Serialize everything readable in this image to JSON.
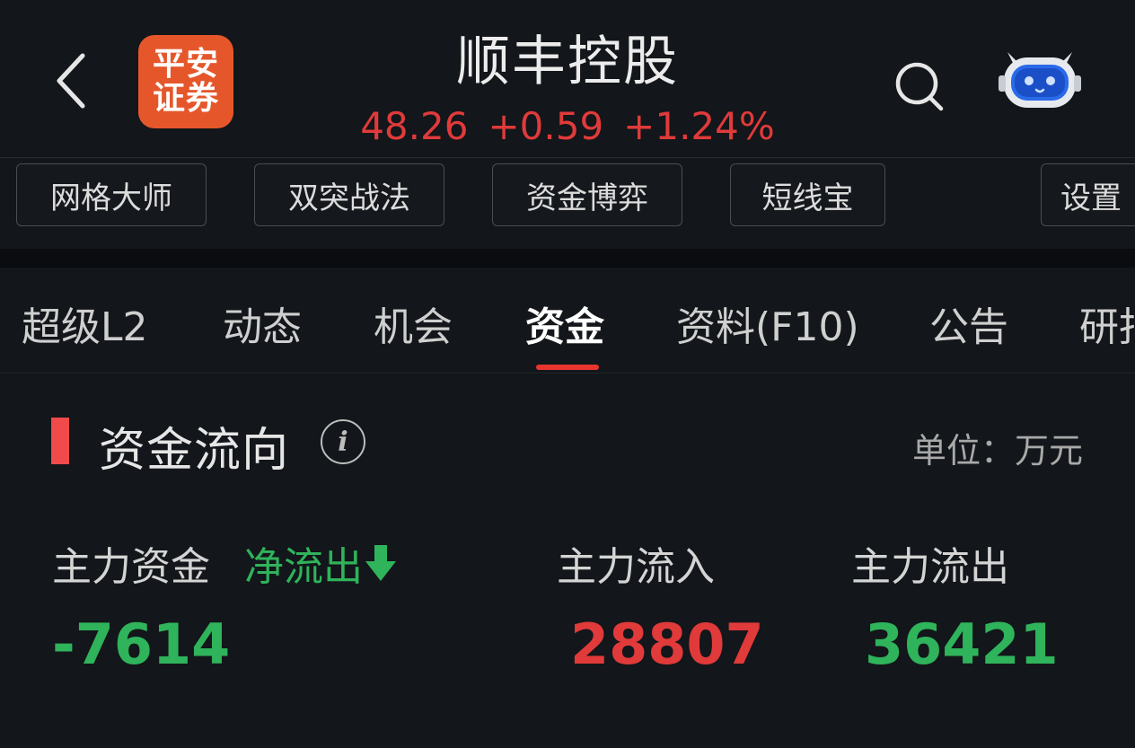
{
  "colors": {
    "background": "#13161a",
    "up_red": "#e03a3a",
    "down_green": "#2fb35b",
    "accent_red": "#e8352e",
    "logo_orange": "#e5572b"
  },
  "header": {
    "back_icon": "chevron-left-icon",
    "logo_line1": "平安",
    "logo_line2": "证券",
    "stock_name": "顺丰控股",
    "price": "48.26",
    "change": "+0.59",
    "change_pct": "+1.24%",
    "search_icon": "search-icon",
    "assistant_icon": "robot-icon"
  },
  "toolbar": {
    "buttons": [
      "网格大师",
      "双突战法",
      "资金博弈",
      "短线宝"
    ],
    "settings_label": "设置"
  },
  "tabs": {
    "items": [
      "超级L2",
      "动态",
      "机会",
      "资金",
      "资料(F10)",
      "公告",
      "研报"
    ],
    "active": "资金"
  },
  "fund_flow": {
    "title": "资金流向",
    "info_icon_glyph": "i",
    "unit_label": "单位：万元",
    "main_fund_label": "主力资金",
    "net_direction_label": "净流出",
    "net_direction_icon": "arrow-down-icon",
    "main_inflow_label": "主力流入",
    "main_outflow_label": "主力流出",
    "net_value": "-7614",
    "inflow_value": "28807",
    "outflow_value": "36421"
  }
}
